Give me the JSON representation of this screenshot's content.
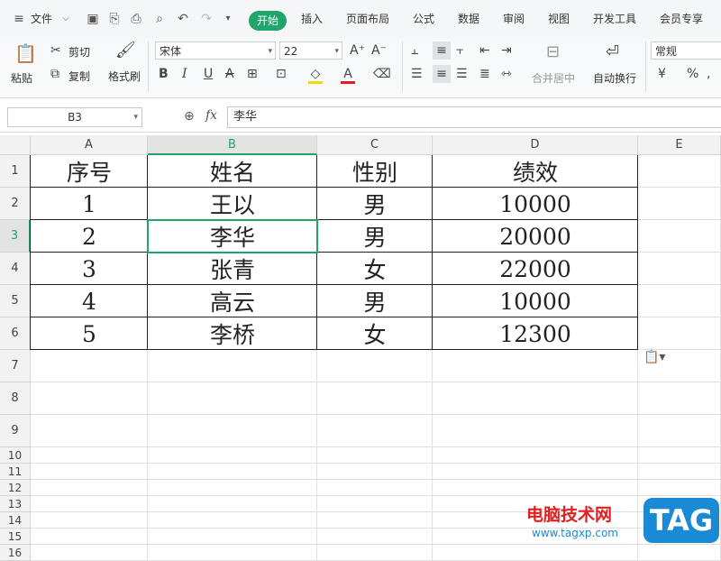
{
  "menubar": {
    "file": "文件",
    "tabs": [
      "开始",
      "插入",
      "页面布局",
      "公式",
      "数据",
      "审阅",
      "视图",
      "开发工具",
      "会员专享"
    ]
  },
  "ribbon": {
    "paste": "粘贴",
    "cut": "剪切",
    "copy": "复制",
    "format_painter": "格式刷",
    "font_name": "宋体",
    "font_size": "22",
    "merge_center": "合并居中",
    "wrap_text": "自动换行",
    "number_format": "常规",
    "currency_symbol": "¥",
    "percent_symbol": "%"
  },
  "formula_bar": {
    "name_box": "B3",
    "fx": "fx",
    "content": "李华"
  },
  "sheet": {
    "columns": [
      "A",
      "B",
      "C",
      "D",
      "E"
    ],
    "rows": [
      "1",
      "2",
      "3",
      "4",
      "5",
      "6",
      "7",
      "8",
      "9",
      "10",
      "11",
      "12",
      "13",
      "14",
      "15",
      "16"
    ],
    "selected_cell": "B3",
    "data": [
      [
        "序号",
        "姓名",
        "性别",
        "绩效"
      ],
      [
        "1",
        "王以",
        "男",
        "10000"
      ],
      [
        "2",
        "李华",
        "男",
        "20000"
      ],
      [
        "3",
        "张青",
        "女",
        "22000"
      ],
      [
        "4",
        "高云",
        "男",
        "10000"
      ],
      [
        "5",
        "李桥",
        "女",
        "12300"
      ]
    ]
  },
  "watermark": {
    "site_name": "电脑技术网",
    "site_url": "www.tagxp.com",
    "logo": "TAG"
  },
  "colors": {
    "accent": "#20a56b",
    "watermark_red": "#e02020",
    "logo_blue": "#1a8ad4"
  }
}
